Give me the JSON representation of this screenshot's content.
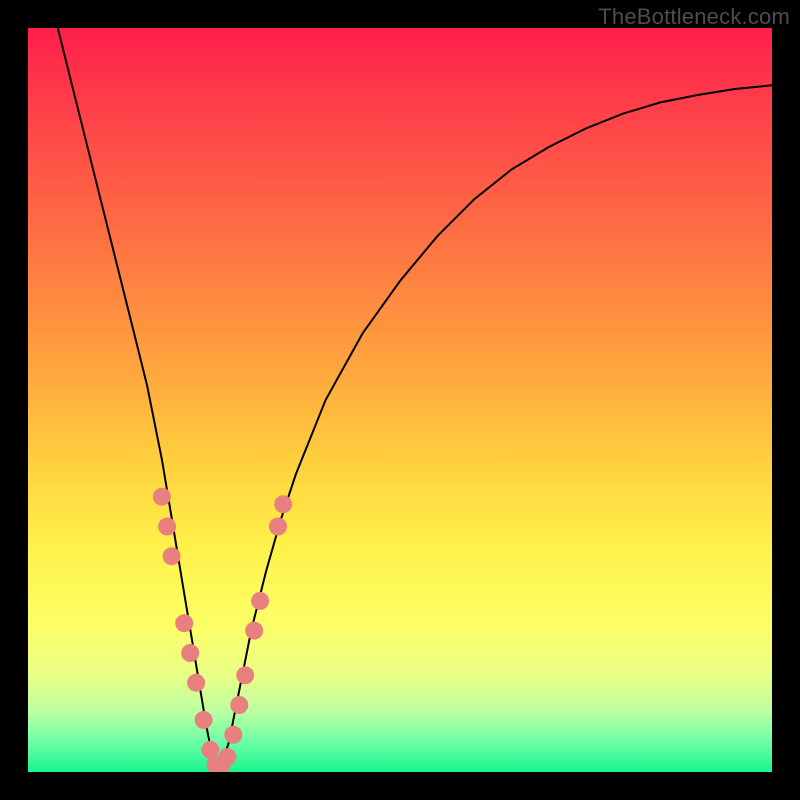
{
  "watermark": "TheBottleneck.com",
  "colors": {
    "frame": "#000000",
    "curve": "#000000",
    "marker": "#e98080",
    "gradient_top": "#ff1f4a",
    "gradient_bottom": "#18f48e"
  },
  "chart_data": {
    "type": "line",
    "title": "",
    "xlabel": "",
    "ylabel": "",
    "xlim": [
      0,
      100
    ],
    "ylim": [
      0,
      100
    ],
    "note": "Axes are unlabeled; values are estimated from pixel positions in a 0–100 normalized space. y≈0 at the green band (bottom), y≈100 at the top. The curve is a sharp V/notch whose minimum sits near x≈25, y≈0.",
    "series": [
      {
        "name": "bottleneck-curve",
        "x": [
          4,
          6,
          8,
          10,
          12,
          14,
          16,
          18,
          19,
          20,
          21,
          22,
          23,
          24,
          25,
          26,
          27,
          28,
          29,
          30,
          32,
          34,
          36,
          40,
          45,
          50,
          55,
          60,
          65,
          70,
          75,
          80,
          85,
          90,
          95,
          100
        ],
        "y": [
          100,
          92,
          84,
          76,
          68,
          60,
          52,
          42,
          36,
          30,
          24,
          18,
          12,
          6,
          1,
          1,
          4,
          9,
          14,
          19,
          27,
          34,
          40,
          50,
          59,
          66,
          72,
          77,
          81,
          84,
          86.5,
          88.5,
          90,
          91,
          91.8,
          92.3
        ]
      }
    ],
    "markers": {
      "name": "highlighted-points",
      "note": "Salmon-colored sample markers clustered near the bottom of the notch on both arms.",
      "points": [
        {
          "x": 18.0,
          "y": 37
        },
        {
          "x": 18.7,
          "y": 33
        },
        {
          "x": 19.3,
          "y": 29
        },
        {
          "x": 21.0,
          "y": 20
        },
        {
          "x": 21.8,
          "y": 16
        },
        {
          "x": 22.6,
          "y": 12
        },
        {
          "x": 23.6,
          "y": 7
        },
        {
          "x": 24.5,
          "y": 3
        },
        {
          "x": 25.2,
          "y": 1
        },
        {
          "x": 26.0,
          "y": 1
        },
        {
          "x": 26.8,
          "y": 2
        },
        {
          "x": 27.6,
          "y": 5
        },
        {
          "x": 28.4,
          "y": 9
        },
        {
          "x": 29.2,
          "y": 13
        },
        {
          "x": 30.4,
          "y": 19
        },
        {
          "x": 31.2,
          "y": 23
        },
        {
          "x": 33.6,
          "y": 33
        },
        {
          "x": 34.3,
          "y": 36
        }
      ]
    }
  }
}
